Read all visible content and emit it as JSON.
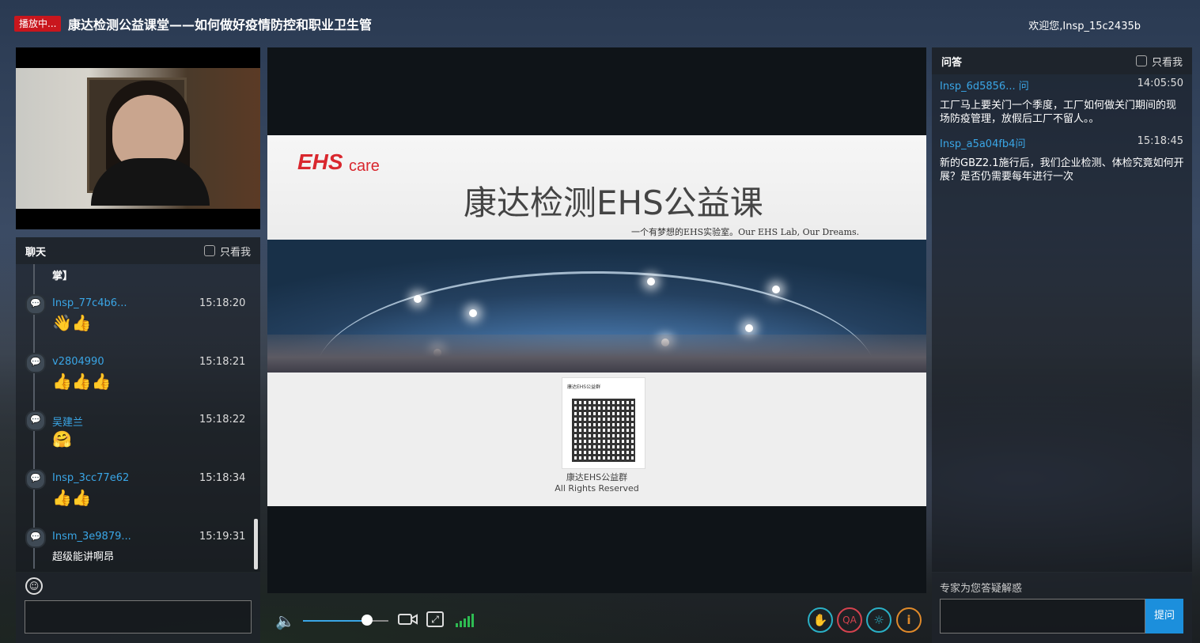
{
  "header": {
    "live_badge": "播放中...",
    "title": "康达检测公益课堂——如何做好疫情防控和职业卫生管",
    "welcome": "欢迎您,Insp_15c2435b"
  },
  "chat": {
    "title": "聊天",
    "only_me": "只看我",
    "fragment": "掌】",
    "messages": [
      {
        "user": "Insp_77c4b6...",
        "time": "15:18:20",
        "content": "👋👍"
      },
      {
        "user": "v2804990",
        "time": "15:18:21",
        "content": "👍👍👍"
      },
      {
        "user": "吴建兰",
        "time": "15:18:22",
        "content": "🤗"
      },
      {
        "user": "Insp_3cc77e62",
        "time": "15:18:34",
        "content": "👍👍"
      },
      {
        "user": "Insm_3e9879...",
        "time": "15:19:31",
        "content": "超级能讲啊昂"
      }
    ],
    "emoji_icon": "smiley-icon"
  },
  "slide": {
    "logo_main": "EHS",
    "logo_sub": "care",
    "title": "康达检测EHS公益课",
    "subtitle": "一个有梦想的EHS实验室。Our EHS Lab, Our Dreams.",
    "qr_header": "康达EHS公益群",
    "qr_caption": "康达EHS公益群",
    "rights": "All Rights Reserved"
  },
  "player": {
    "volume": 0.75,
    "icons": [
      "speaker-icon",
      "camera-icon",
      "fit-screen-icon",
      "signal-icon",
      "raise-hand-icon",
      "qa-icon",
      "settings-icon",
      "info-icon"
    ]
  },
  "qa": {
    "title": "问答",
    "only_me": "只看我",
    "items": [
      {
        "user": "Insp_6d5856... 问",
        "time": "14:05:50",
        "text": "工厂马上要关门一个季度，工厂如何做关门期间的现场防疫管理，放假后工厂不留人。。"
      },
      {
        "user": "Insp_a5a04fb4问",
        "time": "15:18:45",
        "text": "新的GBZ2.1施行后，我们企业检测、体检究竟如何开展？是否仍需要每年进行一次"
      }
    ],
    "hint": "专家为您答疑解惑",
    "submit": "提问"
  }
}
